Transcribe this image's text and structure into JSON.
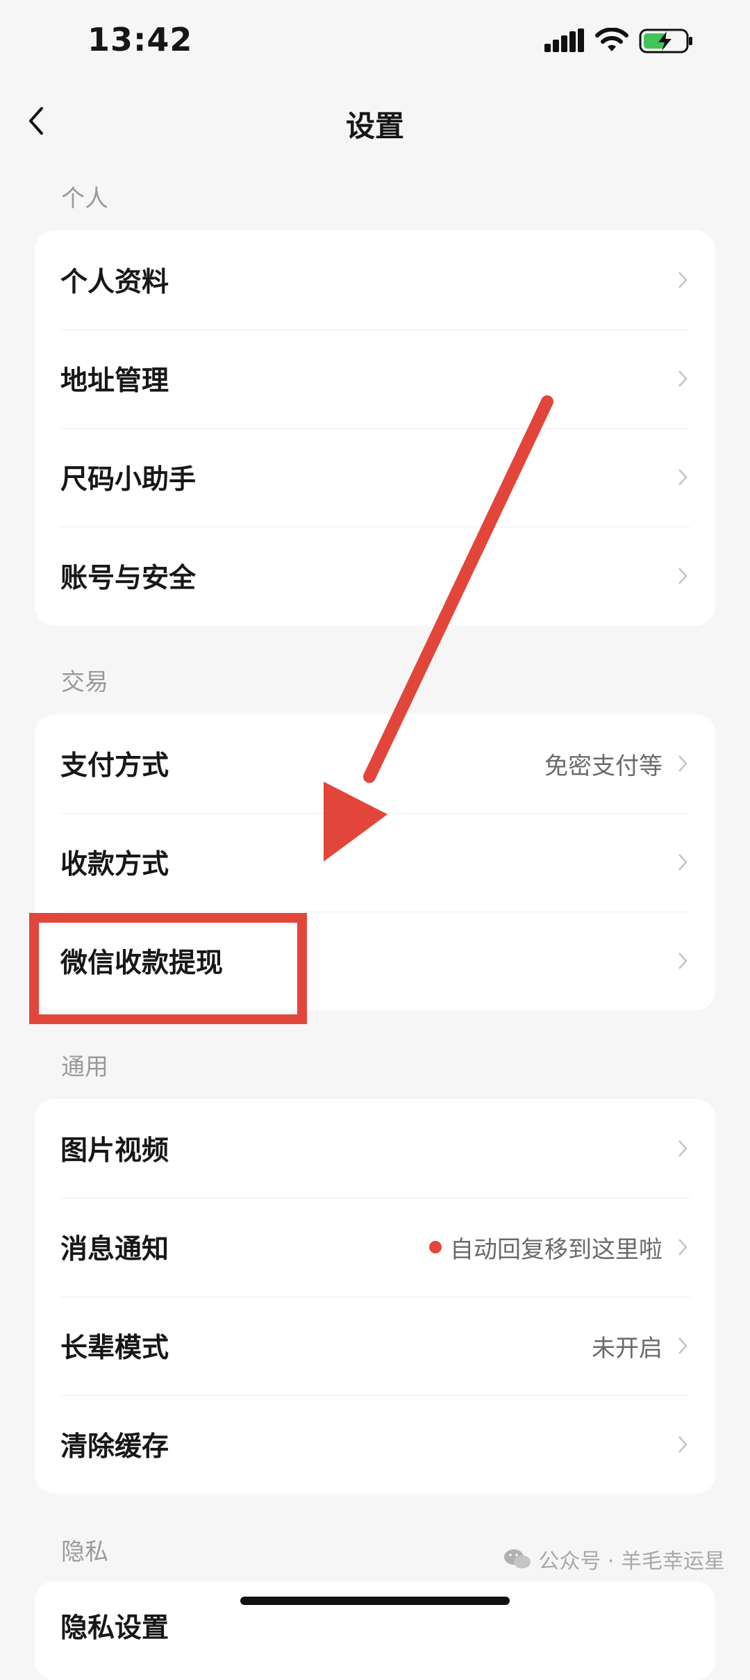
{
  "status_bar": {
    "time": "13:42"
  },
  "nav": {
    "title": "设置"
  },
  "sections": {
    "personal": {
      "label": "个人",
      "items": [
        {
          "label": "个人资料"
        },
        {
          "label": "地址管理"
        },
        {
          "label": "尺码小助手"
        },
        {
          "label": "账号与安全"
        }
      ]
    },
    "trade": {
      "label": "交易",
      "items": [
        {
          "label": "支付方式",
          "value": "免密支付等"
        },
        {
          "label": "收款方式"
        },
        {
          "label": "微信收款提现"
        }
      ]
    },
    "general": {
      "label": "通用",
      "items": [
        {
          "label": "图片视频"
        },
        {
          "label": "消息通知",
          "value": "自动回复移到这里啦",
          "dot": true
        },
        {
          "label": "长辈模式",
          "value": "未开启"
        },
        {
          "label": "清除缓存"
        }
      ]
    },
    "privacy": {
      "label": "隐私",
      "items": [
        {
          "label": "隐私设置"
        }
      ]
    }
  },
  "watermark": {
    "text": "公众号 · 羊毛幸运星"
  },
  "colors": {
    "accent_red": "#e3463a",
    "background": "#f6f6f6",
    "card": "#ffffff"
  }
}
